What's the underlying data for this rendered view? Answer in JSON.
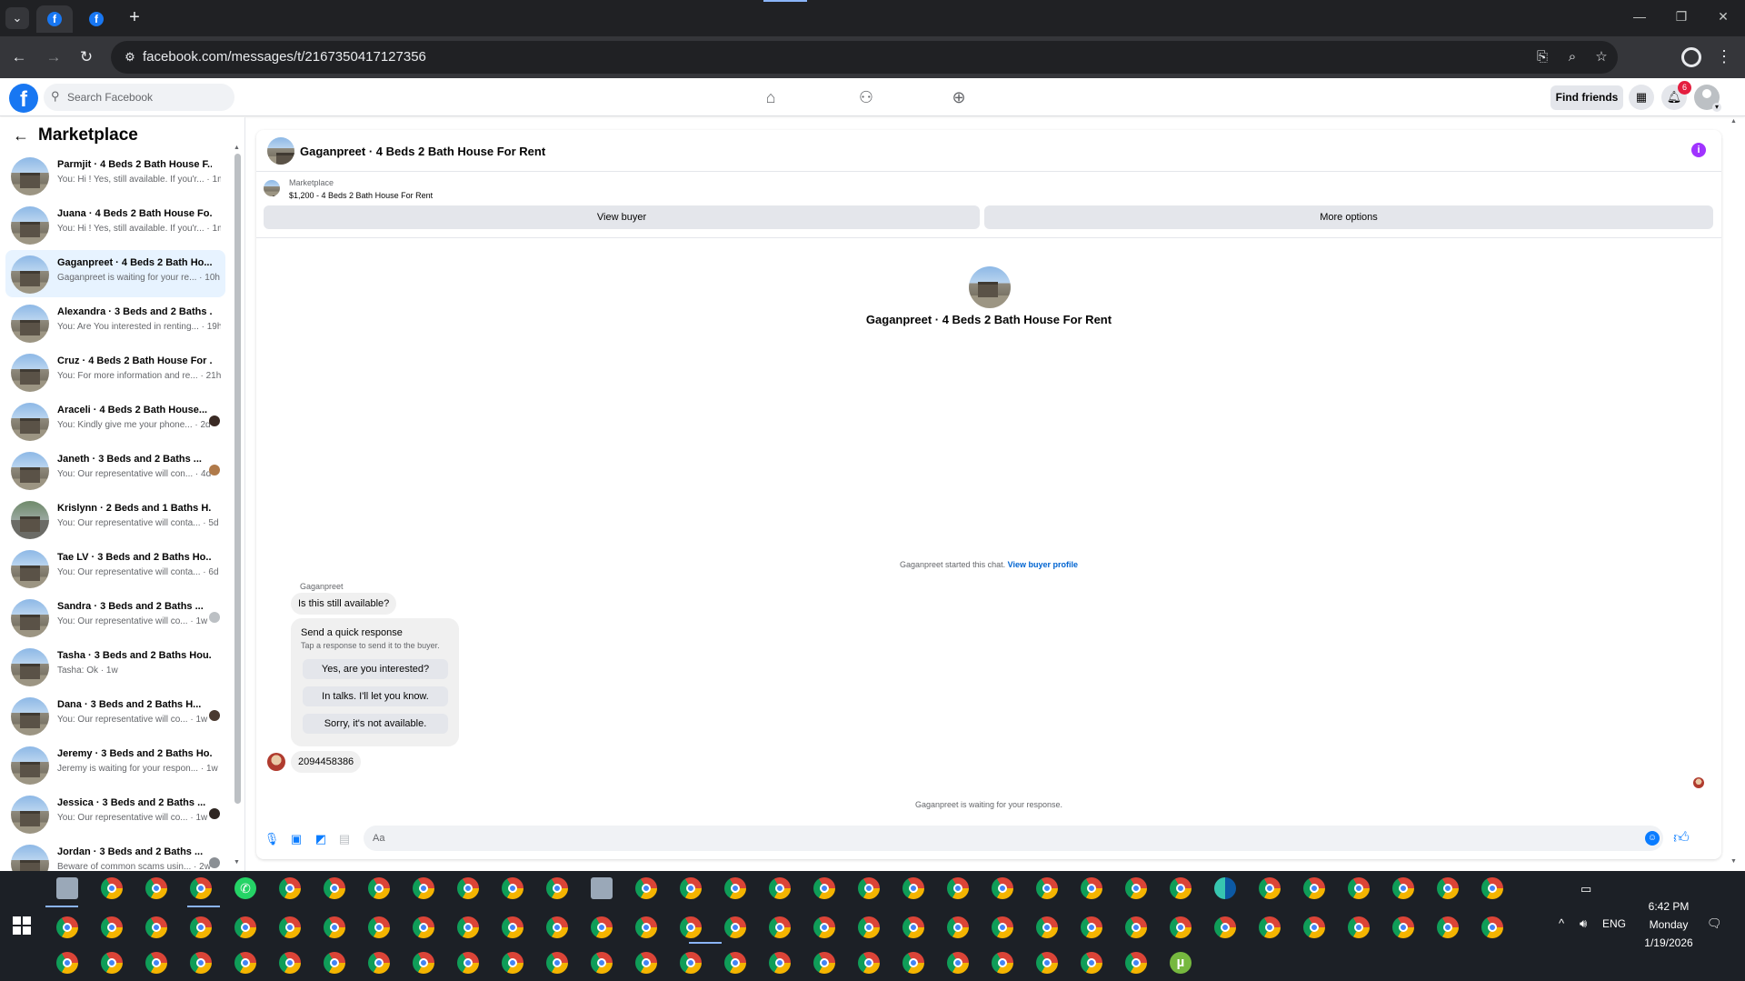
{
  "browser": {
    "url": "facebook.com/messages/t/2167350417127356",
    "new_tab": "+",
    "tab_menu": "⌄"
  },
  "facebook": {
    "logo": "f",
    "search_placeholder": "Search Facebook",
    "find_friends": "Find friends",
    "notifications_count": "6"
  },
  "sidebar": {
    "title": "Marketplace",
    "conversations": [
      {
        "name": "Parmjit · 4 Beds 2 Bath House F...",
        "snippet": "You: Hi ! Yes, still available. If you'r... · 1m"
      },
      {
        "name": "Juana · 4 Beds 2 Bath House Fo...",
        "snippet": "You: Hi ! Yes, still available. If you'r... · 1m"
      },
      {
        "name": "Gaganpreet · 4 Beds 2 Bath Ho...",
        "snippet": "Gaganpreet is waiting for your re... · 10h"
      },
      {
        "name": "Alexandra · 3 Beds and 2 Baths ...",
        "snippet": "You: Are You interested in renting... · 19h"
      },
      {
        "name": "Cruz · 4 Beds 2 Bath House For ...",
        "snippet": "You: For more information and re... · 21h"
      },
      {
        "name": "Araceli · 4 Beds 2 Bath House...",
        "snippet": "You: Kindly give me your phone... · 2d"
      },
      {
        "name": "Janeth · 3 Beds and 2 Baths ...",
        "snippet": "You: Our representative will con... · 4d"
      },
      {
        "name": "Krislynn · 2 Beds and 1 Baths H...",
        "snippet": "You: Our representative will conta... · 5d"
      },
      {
        "name": "Tae LV · 3 Beds and 2 Baths Ho...",
        "snippet": "You: Our representative will conta... · 6d"
      },
      {
        "name": "Sandra · 3 Beds and 2 Baths ...",
        "snippet": "You: Our representative will co... · 1w"
      },
      {
        "name": "Tasha · 3 Beds and 2 Baths Hou...",
        "snippet": "Tasha: Ok · 1w"
      },
      {
        "name": "Dana · 3 Beds and 2 Baths H...",
        "snippet": "You: Our representative will co... · 1w"
      },
      {
        "name": "Jeremy · 3 Beds and 2 Baths Ho...",
        "snippet": "Jeremy is waiting for your respon... · 1w"
      },
      {
        "name": "Jessica · 3 Beds and 2 Baths ...",
        "snippet": "You: Our representative will co... · 1w"
      },
      {
        "name": "Jordan · 3 Beds and 2 Baths ...",
        "snippet": "Beware of common scams usin... · 2w"
      }
    ]
  },
  "chat": {
    "header_title": "Gaganpreet · 4 Beds 2 Bath House For Rent",
    "marketplace_label": "Marketplace",
    "listing": "$1,200 - 4 Beds 2 Bath House For Rent",
    "view_buyer": "View buyer",
    "more_options": "More options",
    "center_title": "Gaganpreet · 4 Beds 2 Bath House For Rent",
    "started_text": "Gaganpreet started this chat.",
    "view_buyer_profile": "View buyer profile",
    "sender": "Gaganpreet",
    "message1": "Is this still available?",
    "quick_title": "Send a quick response",
    "quick_subtitle": "Tap a response to send it to the buyer.",
    "quick_responses": [
      "Yes, are you interested?",
      "In talks. I'll let you know.",
      "Sorry, it's not available."
    ],
    "message2": "2094458386",
    "waiting_text": "Gaganpreet is waiting for your response.",
    "composer_placeholder": "Aa"
  },
  "taskbar": {
    "time": "6:42 PM",
    "day": "Monday",
    "date": "1/19/2026",
    "language": "ENG"
  }
}
